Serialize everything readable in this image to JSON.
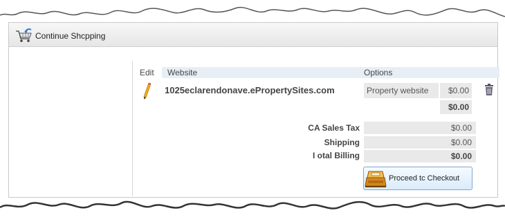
{
  "toolbar": {
    "continue_label": "Continue Shcpping"
  },
  "table": {
    "headers": {
      "edit": "Edit",
      "website": "Website",
      "options": "Options"
    },
    "item": {
      "website": "1025eclarendonave.ePropertySites.com",
      "option": "Property website",
      "price": "$0.00"
    },
    "subtotal": "$0.00"
  },
  "totals": [
    {
      "label": "CA Sales Tax",
      "value": "$0.00"
    },
    {
      "label": "Shipping",
      "value": "$0.00"
    },
    {
      "label": "I otal Billing",
      "value": "$0.00"
    }
  ],
  "checkout_label": "Proceed tc Checkout"
}
